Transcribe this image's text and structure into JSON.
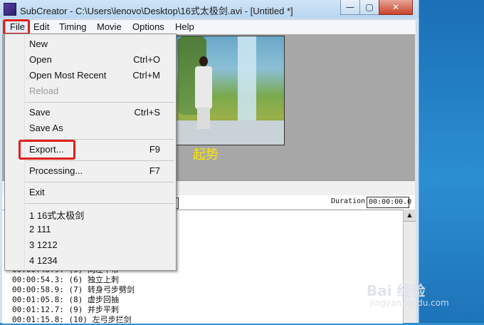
{
  "window": {
    "title": "SubCreator - C:\\Users\\lenovo\\Desktop\\16式太极剑.avi - [Untitled *]",
    "minimize_glyph": "—",
    "maximize_glyph": "▢",
    "close_glyph": "✕"
  },
  "menubar": {
    "items": [
      "File",
      "Edit",
      "Timing",
      "Movie",
      "Options",
      "Help"
    ]
  },
  "file_menu": {
    "items": [
      {
        "label": "New",
        "shortcut": ""
      },
      {
        "label": "Open",
        "shortcut": "Ctrl+O"
      },
      {
        "label": "Open Most Recent",
        "shortcut": "Ctrl+M"
      },
      {
        "label": "Reload",
        "shortcut": "",
        "disabled": true
      },
      {
        "label": "Save",
        "shortcut": "Ctrl+S"
      },
      {
        "label": "Save As",
        "shortcut": ""
      },
      {
        "label": "Export...",
        "shortcut": "F9"
      },
      {
        "label": "Processing...",
        "shortcut": "F7"
      },
      {
        "label": "Exit",
        "shortcut": ""
      },
      {
        "label": "1 16式太极剑",
        "shortcut": ""
      },
      {
        "label": "2 111",
        "shortcut": ""
      },
      {
        "label": "3 1212",
        "shortcut": ""
      },
      {
        "label": "4 1234",
        "shortcut": ""
      }
    ]
  },
  "video": {
    "subtitle": "起势"
  },
  "controls": {
    "duration_label": "Duration",
    "duration_value": "00:00:00.0"
  },
  "subtitle_list": [
    "00:00:48.9: (5) 向左平带",
    "00:00:54.3: (6) 独立上刺",
    "00:00:58.9: (7) 转身弓步劈剑",
    "00:01:05.8: (8) 虚步回抽",
    "00:01:12.7: (9) 并步平刺",
    "00:01:15.8: (10) 左弓步拦剑"
  ],
  "watermark": {
    "main": "Bai 经验",
    "sub": "jingyan.baidu.com"
  },
  "colors": {
    "highlight_box": "#e0201c",
    "subtitle_color": "#ffe600"
  }
}
